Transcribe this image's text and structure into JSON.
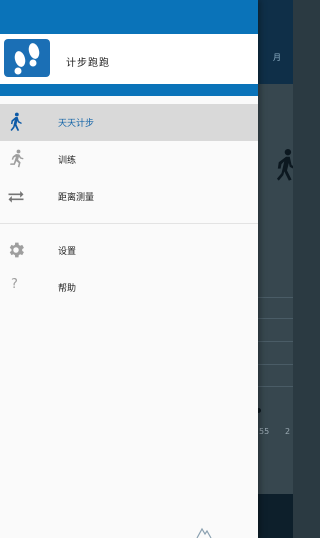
{
  "background": {
    "tab_label": "月",
    "axis_labels": [
      "55",
      "2"
    ]
  },
  "drawer": {
    "app_name": "计步跑跑",
    "menu": [
      {
        "label": "天天计步",
        "icon": "walking-person-icon",
        "selected": true
      },
      {
        "label": "训练",
        "icon": "running-person-icon",
        "selected": false
      },
      {
        "label": "距离测量",
        "icon": "swap-arrows-icon",
        "selected": false
      }
    ],
    "secondary_menu": [
      {
        "label": "设置",
        "icon": "gear-icon"
      },
      {
        "label": "帮助",
        "icon": "help-icon",
        "glyph": "?"
      }
    ]
  },
  "colors": {
    "primary": "#0a73b9",
    "selected_bg": "#d9d9d9",
    "selected_text": "#1565a8",
    "icon_gray": "#9e9e9e",
    "selected_icon": "#0d5aa7"
  }
}
